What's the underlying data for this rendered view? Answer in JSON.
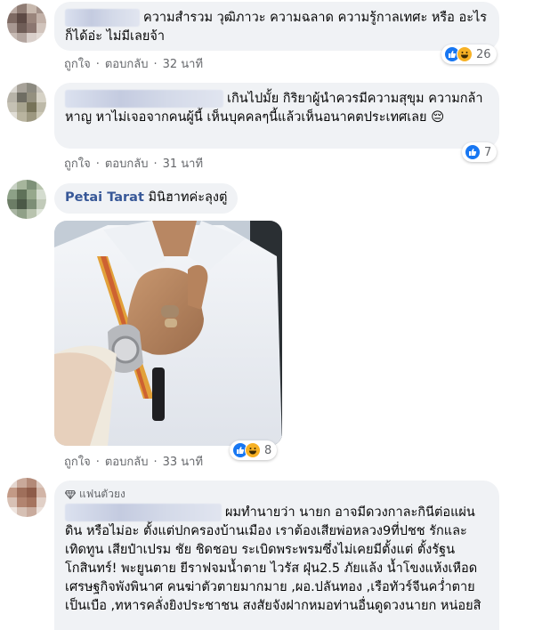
{
  "comments": [
    {
      "text": "ความสำรวม วุฒิภาวะ ความฉลาด ความรู้กาลเทศะ หรือ อะไรก็ได้อ่ะ ไม่มีเลยจ้า",
      "like_label": "ถูกใจ",
      "reply_label": "ตอบกลับ",
      "time": "32 นาที",
      "reaction_count": "26",
      "reactions": [
        "like-icon",
        "haha-icon"
      ]
    },
    {
      "text": "เกินไปมั้ย กิริยาผู้นำควรมีความสุขุม ความกล้าหาญ หาไม่เจอจากคนผู้นี้ เห็นบุคคลๆนี้แล้วเห็นอนาคตประเทศเลย 😔",
      "like_label": "ถูกใจ",
      "reply_label": "ตอบกลับ",
      "time": "31 นาที",
      "reaction_count": "7",
      "reactions": [
        "like-icon"
      ]
    },
    {
      "author": "Petai Tarat",
      "text": "มินิฮาทค่ะลุงตู่",
      "like_label": "ถูกใจ",
      "reply_label": "ตอบกลับ",
      "time": "33 นาที",
      "reaction_count": "8",
      "reactions": [
        "like-icon",
        "haha-icon"
      ]
    },
    {
      "badge": "แฟนตัวยง",
      "text": "ผมทำนายว่า นายก อาจมีดวงกาละกินีต่อแผ่นดิน หรือไม่อะ ตั้งแต่ปกครองบ้านเมือง เราต้องเสียพ่อหลวง9ที่ปชช รักและเทิดทูน เสียป๋าเปรม ชัย ชิดชอบ ระเบิดพระพรมซึ่งไม่เคยมีตั้งแต่ ตั้งรัฐนโกสินทร์! พะยูนตาย ยีราฟจมน้ำตาย ไวรัส ฝุ่น2.5 ภัยแล้ง น้ำโขงแห้งเหือด เศรษฐกิจพังพินาศ คนฆ่าตัวตายมากมาย ,ผอ.ปลันทอง ,เรือทัวร์จีนคว่ำตายเป็นเบือ ,ทหารคลั่งยิงประชาชน สงสัยจังฝากหมอท่านอื่นดูดวงนายก หน่อยสิ"
    }
  ],
  "colors": {
    "bubble": "#f0f2f5",
    "author": "#385898",
    "meta": "#65676b",
    "like": "#1877f2",
    "haha": "#f7b125"
  }
}
